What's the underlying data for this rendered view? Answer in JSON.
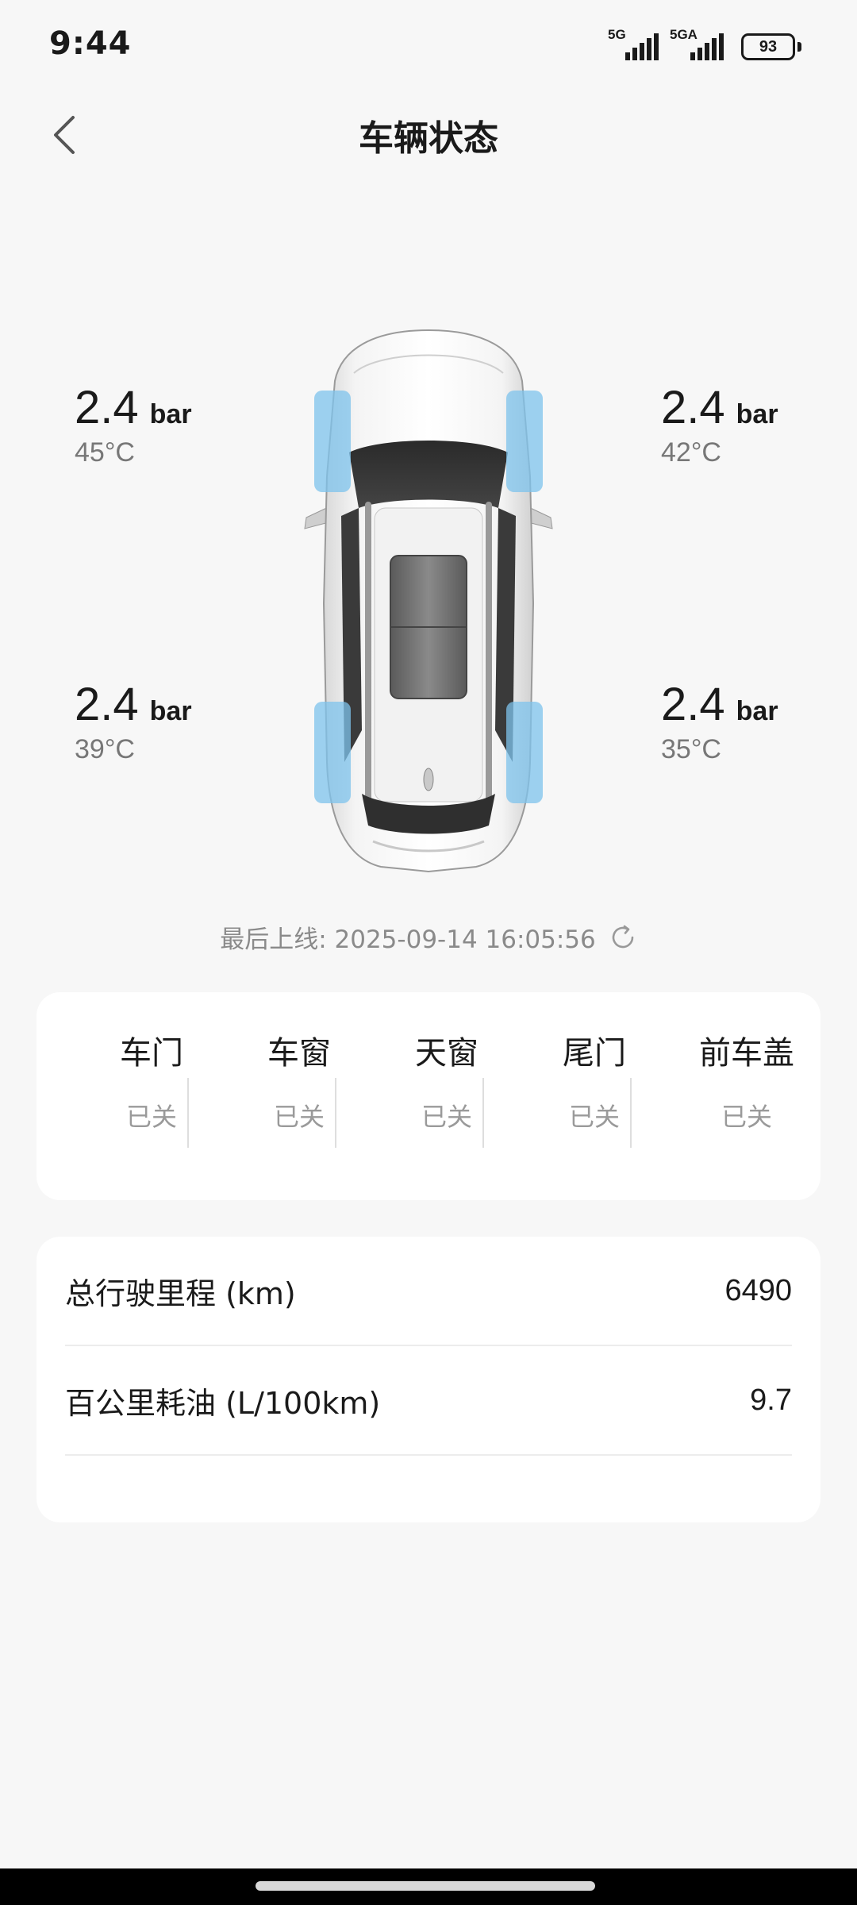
{
  "status_bar": {
    "time": "9:44",
    "signal1_label": "5G",
    "signal2_label": "5GA",
    "battery": "93"
  },
  "header": {
    "title": "车辆状态",
    "back_icon": "chevron-left-icon"
  },
  "tires": {
    "front_left": {
      "pressure": "2.4",
      "unit": "bar",
      "temp": "45°C"
    },
    "front_right": {
      "pressure": "2.4",
      "unit": "bar",
      "temp": "42°C"
    },
    "rear_left": {
      "pressure": "2.4",
      "unit": "bar",
      "temp": "39°C"
    },
    "rear_right": {
      "pressure": "2.4",
      "unit": "bar",
      "temp": "35°C"
    },
    "highlight_color": "#7ec3ec"
  },
  "last_online": {
    "text": "最后上线: 2025-09-14 16:05:56",
    "refresh_icon": "refresh-icon"
  },
  "closure_status": [
    {
      "label": "车门",
      "value": "已关"
    },
    {
      "label": "车窗",
      "value": "已关"
    },
    {
      "label": "天窗",
      "value": "已关"
    },
    {
      "label": "尾门",
      "value": "已关"
    },
    {
      "label": "前车盖",
      "value": "已关"
    }
  ],
  "stats": [
    {
      "label": "总行驶里程 (km)",
      "value": "6490"
    },
    {
      "label": "百公里耗油 (L/100km)",
      "value": "9.7"
    }
  ]
}
